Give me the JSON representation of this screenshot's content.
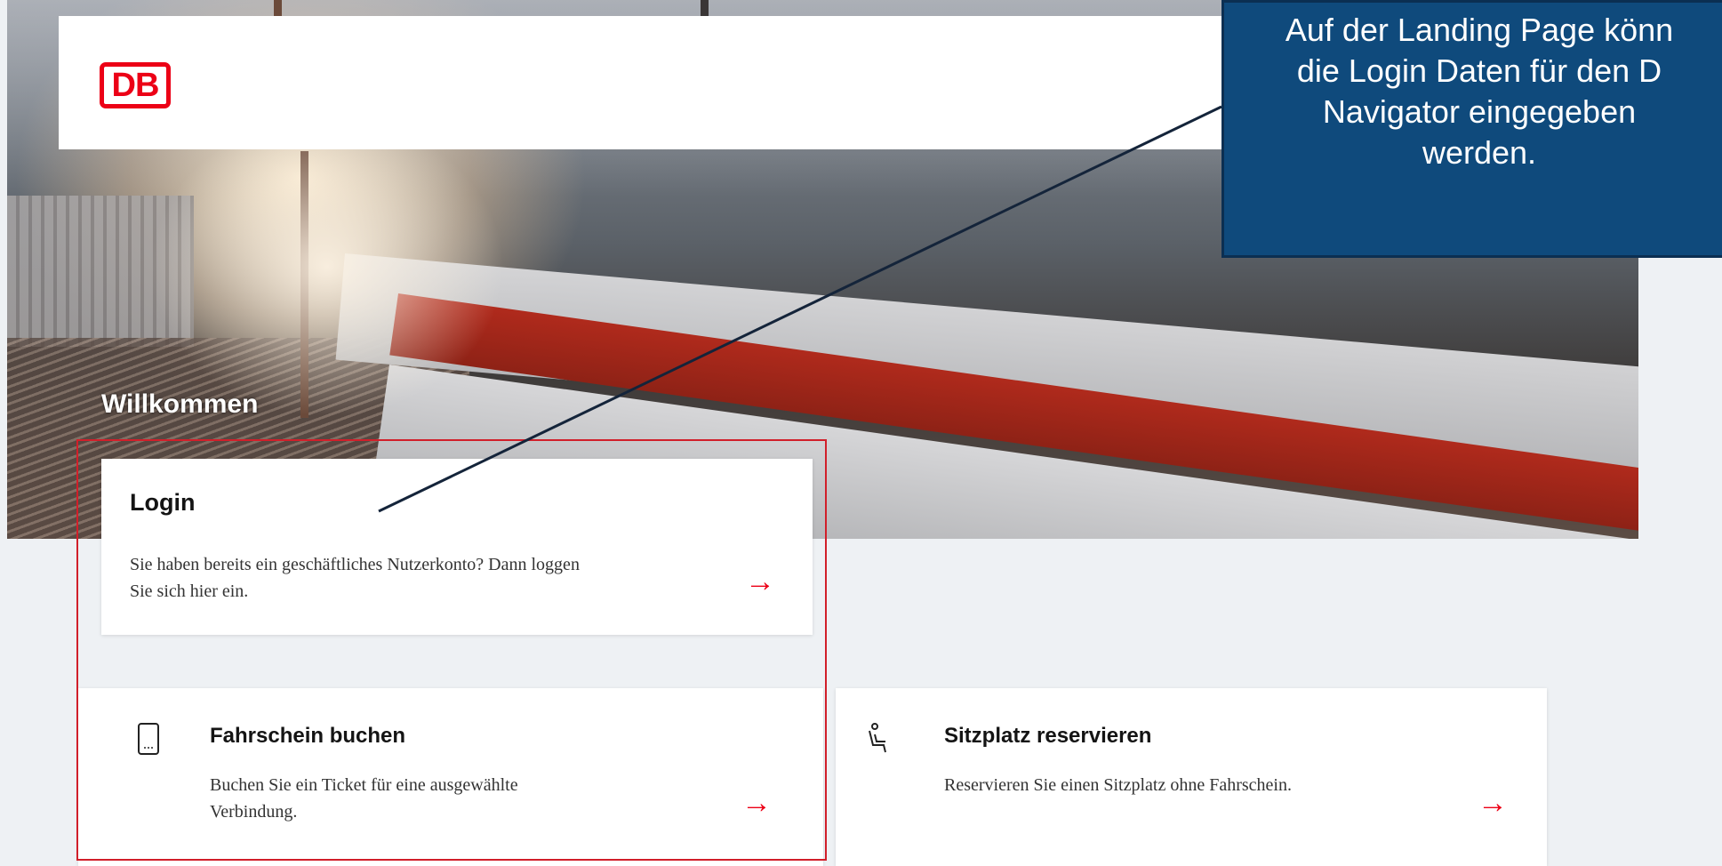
{
  "header": {
    "logo_text": "DB"
  },
  "callout": {
    "lines": [
      "Auf der Landing Page könn",
      "die Login Daten für den D",
      "Navigator eingegeben",
      "werden."
    ]
  },
  "hero": {
    "welcome": "Willkommen"
  },
  "cards": {
    "login": {
      "title": "Login",
      "desc_line1": "Sie haben bereits ein geschäftliches Nutzerkonto? Dann loggen",
      "desc_line2": "Sie sich hier ein.",
      "arrow": "→"
    },
    "ticket": {
      "title": "Fahrschein buchen",
      "desc_line1": "Buchen Sie ein Ticket für eine ausgewählte",
      "desc_line2": "Verbindung.",
      "icon": "ticket-phone-icon",
      "arrow": "→"
    },
    "seat": {
      "title": "Sitzplatz reservieren",
      "desc_line1": "Reservieren Sie einen Sitzplatz ohne Fahrschein.",
      "icon": "seat-icon",
      "arrow": "→"
    }
  },
  "colors": {
    "brand_red": "#ec0016",
    "callout_blue": "#0f4a7c",
    "page_bg": "#eef1f4"
  }
}
